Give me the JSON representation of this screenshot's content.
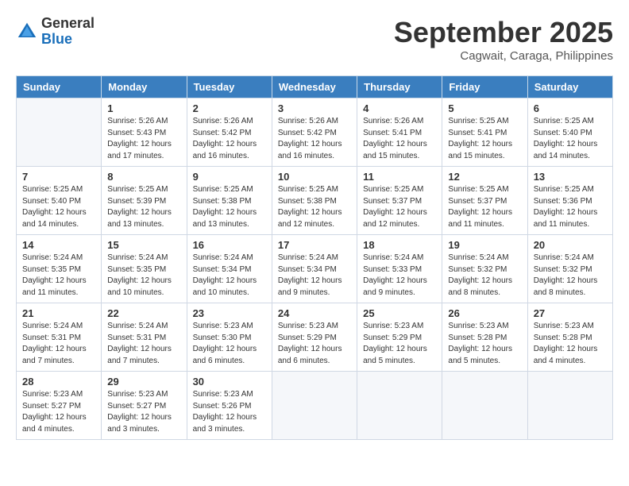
{
  "header": {
    "logo_general": "General",
    "logo_blue": "Blue",
    "month_title": "September 2025",
    "location": "Cagwait, Caraga, Philippines"
  },
  "weekdays": [
    "Sunday",
    "Monday",
    "Tuesday",
    "Wednesday",
    "Thursday",
    "Friday",
    "Saturday"
  ],
  "weeks": [
    [
      {
        "day": "",
        "info": ""
      },
      {
        "day": "1",
        "info": "Sunrise: 5:26 AM\nSunset: 5:43 PM\nDaylight: 12 hours\nand 17 minutes."
      },
      {
        "day": "2",
        "info": "Sunrise: 5:26 AM\nSunset: 5:42 PM\nDaylight: 12 hours\nand 16 minutes."
      },
      {
        "day": "3",
        "info": "Sunrise: 5:26 AM\nSunset: 5:42 PM\nDaylight: 12 hours\nand 16 minutes."
      },
      {
        "day": "4",
        "info": "Sunrise: 5:26 AM\nSunset: 5:41 PM\nDaylight: 12 hours\nand 15 minutes."
      },
      {
        "day": "5",
        "info": "Sunrise: 5:25 AM\nSunset: 5:41 PM\nDaylight: 12 hours\nand 15 minutes."
      },
      {
        "day": "6",
        "info": "Sunrise: 5:25 AM\nSunset: 5:40 PM\nDaylight: 12 hours\nand 14 minutes."
      }
    ],
    [
      {
        "day": "7",
        "info": "Sunrise: 5:25 AM\nSunset: 5:40 PM\nDaylight: 12 hours\nand 14 minutes."
      },
      {
        "day": "8",
        "info": "Sunrise: 5:25 AM\nSunset: 5:39 PM\nDaylight: 12 hours\nand 13 minutes."
      },
      {
        "day": "9",
        "info": "Sunrise: 5:25 AM\nSunset: 5:38 PM\nDaylight: 12 hours\nand 13 minutes."
      },
      {
        "day": "10",
        "info": "Sunrise: 5:25 AM\nSunset: 5:38 PM\nDaylight: 12 hours\nand 12 minutes."
      },
      {
        "day": "11",
        "info": "Sunrise: 5:25 AM\nSunset: 5:37 PM\nDaylight: 12 hours\nand 12 minutes."
      },
      {
        "day": "12",
        "info": "Sunrise: 5:25 AM\nSunset: 5:37 PM\nDaylight: 12 hours\nand 11 minutes."
      },
      {
        "day": "13",
        "info": "Sunrise: 5:25 AM\nSunset: 5:36 PM\nDaylight: 12 hours\nand 11 minutes."
      }
    ],
    [
      {
        "day": "14",
        "info": "Sunrise: 5:24 AM\nSunset: 5:35 PM\nDaylight: 12 hours\nand 11 minutes."
      },
      {
        "day": "15",
        "info": "Sunrise: 5:24 AM\nSunset: 5:35 PM\nDaylight: 12 hours\nand 10 minutes."
      },
      {
        "day": "16",
        "info": "Sunrise: 5:24 AM\nSunset: 5:34 PM\nDaylight: 12 hours\nand 10 minutes."
      },
      {
        "day": "17",
        "info": "Sunrise: 5:24 AM\nSunset: 5:34 PM\nDaylight: 12 hours\nand 9 minutes."
      },
      {
        "day": "18",
        "info": "Sunrise: 5:24 AM\nSunset: 5:33 PM\nDaylight: 12 hours\nand 9 minutes."
      },
      {
        "day": "19",
        "info": "Sunrise: 5:24 AM\nSunset: 5:32 PM\nDaylight: 12 hours\nand 8 minutes."
      },
      {
        "day": "20",
        "info": "Sunrise: 5:24 AM\nSunset: 5:32 PM\nDaylight: 12 hours\nand 8 minutes."
      }
    ],
    [
      {
        "day": "21",
        "info": "Sunrise: 5:24 AM\nSunset: 5:31 PM\nDaylight: 12 hours\nand 7 minutes."
      },
      {
        "day": "22",
        "info": "Sunrise: 5:24 AM\nSunset: 5:31 PM\nDaylight: 12 hours\nand 7 minutes."
      },
      {
        "day": "23",
        "info": "Sunrise: 5:23 AM\nSunset: 5:30 PM\nDaylight: 12 hours\nand 6 minutes."
      },
      {
        "day": "24",
        "info": "Sunrise: 5:23 AM\nSunset: 5:29 PM\nDaylight: 12 hours\nand 6 minutes."
      },
      {
        "day": "25",
        "info": "Sunrise: 5:23 AM\nSunset: 5:29 PM\nDaylight: 12 hours\nand 5 minutes."
      },
      {
        "day": "26",
        "info": "Sunrise: 5:23 AM\nSunset: 5:28 PM\nDaylight: 12 hours\nand 5 minutes."
      },
      {
        "day": "27",
        "info": "Sunrise: 5:23 AM\nSunset: 5:28 PM\nDaylight: 12 hours\nand 4 minutes."
      }
    ],
    [
      {
        "day": "28",
        "info": "Sunrise: 5:23 AM\nSunset: 5:27 PM\nDaylight: 12 hours\nand 4 minutes."
      },
      {
        "day": "29",
        "info": "Sunrise: 5:23 AM\nSunset: 5:27 PM\nDaylight: 12 hours\nand 3 minutes."
      },
      {
        "day": "30",
        "info": "Sunrise: 5:23 AM\nSunset: 5:26 PM\nDaylight: 12 hours\nand 3 minutes."
      },
      {
        "day": "",
        "info": ""
      },
      {
        "day": "",
        "info": ""
      },
      {
        "day": "",
        "info": ""
      },
      {
        "day": "",
        "info": ""
      }
    ]
  ]
}
